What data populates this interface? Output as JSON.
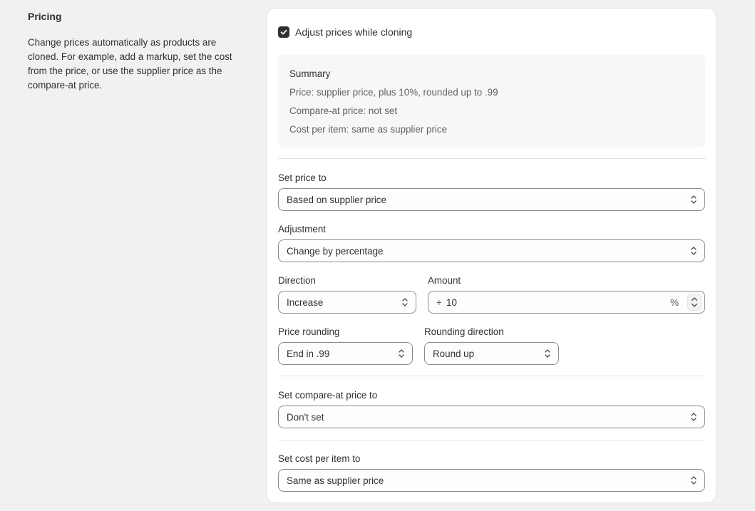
{
  "section": {
    "title": "Pricing",
    "description": "Change prices automatically as products are cloned. For example, add a markup, set the cost from the price, or use the supplier price as the compare-at price."
  },
  "adjust_checkbox": {
    "label": "Adjust prices while cloning",
    "checked": true
  },
  "summary": {
    "title": "Summary",
    "lines": [
      "Price: supplier price, plus 10%, rounded up to .99",
      "Compare-at price: not set",
      "Cost per item: same as supplier price"
    ]
  },
  "set_price": {
    "label": "Set price to",
    "value": "Based on supplier price"
  },
  "adjustment": {
    "label": "Adjustment",
    "value": "Change by percentage"
  },
  "direction": {
    "label": "Direction",
    "value": "Increase"
  },
  "amount": {
    "label": "Amount",
    "prefix": "+",
    "value": "10",
    "suffix": "%"
  },
  "price_rounding": {
    "label": "Price rounding",
    "value": "End in .99"
  },
  "rounding_direction": {
    "label": "Rounding direction",
    "value": "Round up"
  },
  "compare_at": {
    "label": "Set compare-at price to",
    "value": "Don't set"
  },
  "cost_per_item": {
    "label": "Set cost per item to",
    "value": "Same as supplier price"
  },
  "colors": {
    "background": "#f1f1f1",
    "card": "#ffffff",
    "checkbox": "#303030",
    "summary_bg": "#f7f7f7",
    "border": "#8a8a8a"
  },
  "icons": {
    "checkbox": "checkmark-icon",
    "select": "chevron-up-down-icon",
    "stepper": "stepper-arrows-icon"
  }
}
